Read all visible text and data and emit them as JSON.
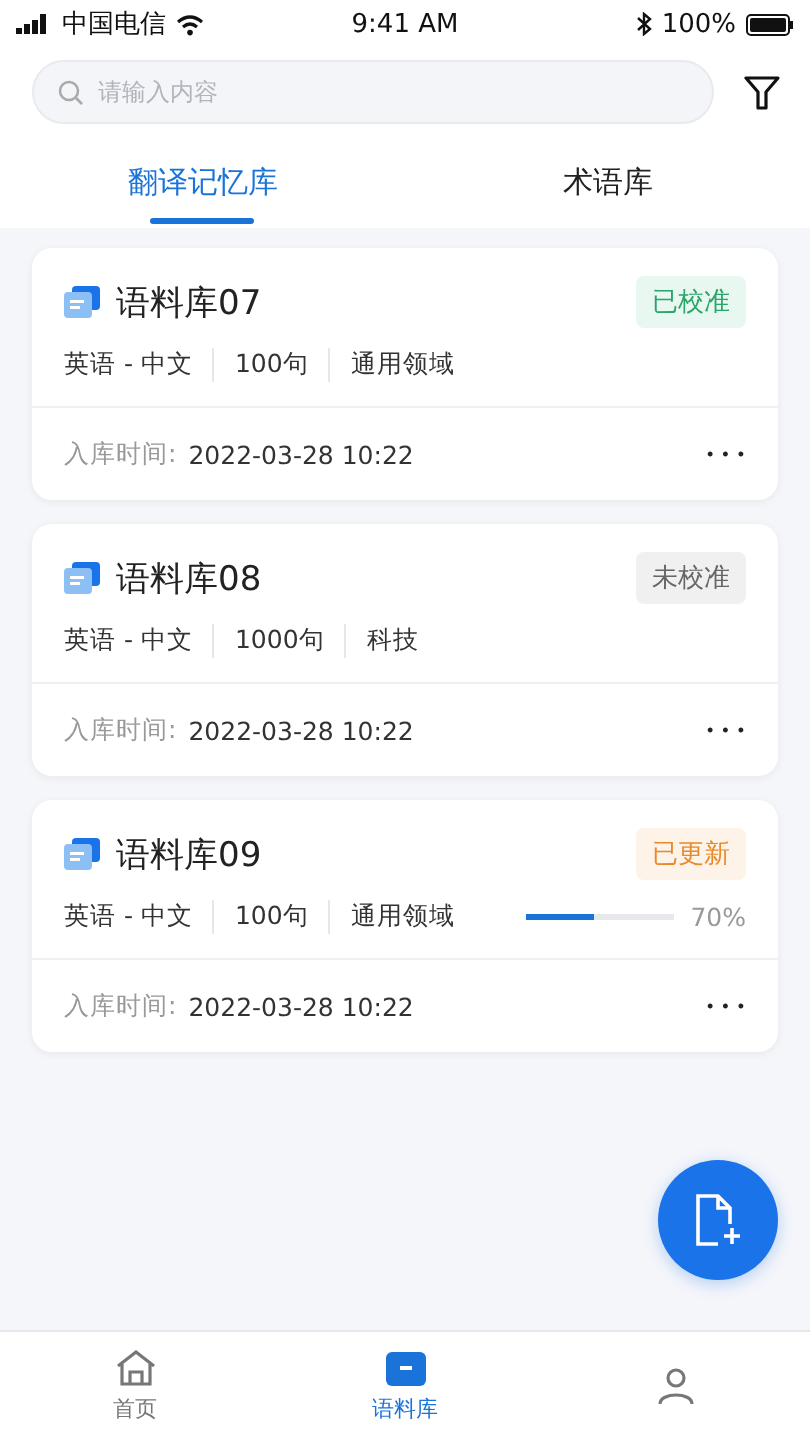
{
  "status_bar": {
    "carrier": "中国电信",
    "time": "9:41 AM",
    "battery": "100%"
  },
  "search": {
    "placeholder": "请输入内容"
  },
  "tabs": [
    {
      "label": "翻译记忆库",
      "selected": true
    },
    {
      "label": "术语库",
      "selected": false
    }
  ],
  "corpora": [
    {
      "name": "语料库07",
      "status": "已校准",
      "kind": "calibrated",
      "languages": "英语 - 中文",
      "count": "100句",
      "domain": "通用领域",
      "time_label": "入库时间:",
      "time": "2022-03-28 10:22",
      "more": "• • •"
    },
    {
      "name": "语料库08",
      "status": "未校准",
      "kind": "uncalibrated",
      "languages": "英语 - 中文",
      "count": "1000句",
      "domain": "科技",
      "time_label": "入库时间:",
      "time": "2022-03-28 10:22",
      "more": "• • •"
    },
    {
      "name": "语料库09",
      "status": "已更新",
      "kind": "updated",
      "languages": "英语 - 中文",
      "count": "100句",
      "domain": "通用领域",
      "progress": {
        "level": 0.45,
        "reading": "70%"
      },
      "time_label": "入库时间:",
      "time": "2022-03-28 10:22",
      "more": "• • •"
    }
  ],
  "bottom_nav": [
    {
      "label": "首页",
      "kind": "home",
      "selected": false
    },
    {
      "label": "语料库",
      "kind": "corpus",
      "selected": true
    },
    {
      "kind": "user",
      "selected": false
    }
  ]
}
